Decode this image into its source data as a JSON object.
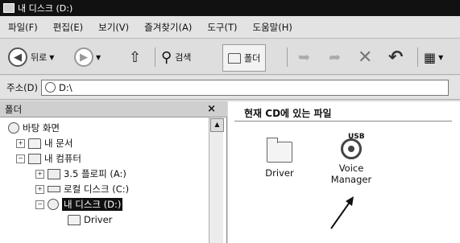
{
  "window": {
    "title": "내 디스크 (D:)"
  },
  "menu": [
    "파일(F)",
    "편집(E)",
    "보기(V)",
    "즐겨찾기(A)",
    "도구(T)",
    "도움말(H)"
  ],
  "toolbar": {
    "back_label": "뒤로",
    "search_label": "검색",
    "folders_label": "폴더"
  },
  "address": {
    "label": "주소(D)",
    "value": "D:\\"
  },
  "folder_pane": {
    "title": "폴더",
    "close": "×",
    "tree": [
      {
        "label": "바탕 화면"
      },
      {
        "label": "내 문서",
        "expander": "+"
      },
      {
        "label": "내 컴퓨터",
        "expander": "−"
      },
      {
        "label": "3.5 플로피 (A:)",
        "expander": "+"
      },
      {
        "label": "로컬 디스크 (C:)",
        "expander": "+"
      },
      {
        "label": "내 디스크 (D:)",
        "expander": "−"
      },
      {
        "label": "Driver"
      }
    ]
  },
  "content": {
    "header": "현재 CD에 있는 파일",
    "files": [
      {
        "name": "Driver",
        "icon": "folder-icon"
      },
      {
        "name_line1": "Voice",
        "name_line2": "Manager",
        "icon": "usb-app-icon",
        "icon_text": "USB"
      }
    ]
  }
}
